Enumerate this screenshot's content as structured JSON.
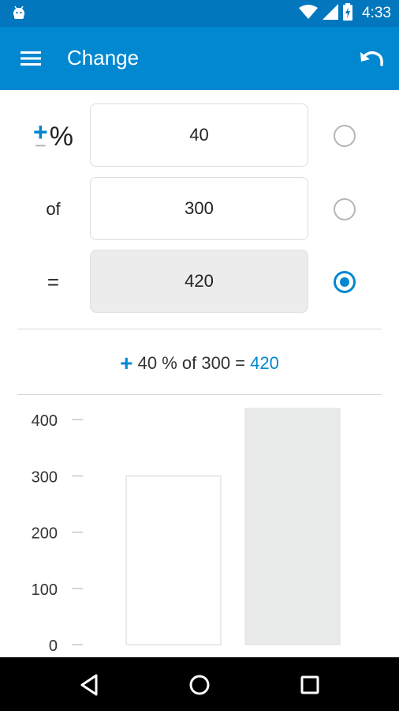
{
  "status_bar": {
    "time": "4:33"
  },
  "app_bar": {
    "title": "Change"
  },
  "calculator": {
    "sign_plus": "+",
    "sign_minus": "−",
    "percent_symbol": "%",
    "percent_value": "40",
    "of_label": "of",
    "base_value": "300",
    "equals_label": "=",
    "result_value": "420",
    "selected_radio": "result"
  },
  "summary": {
    "sign": "+",
    "text": " 40 % of 300 = ",
    "result": "420"
  },
  "chart_data": {
    "type": "bar",
    "categories": [
      "",
      ""
    ],
    "values": [
      300,
      420
    ],
    "ylim": [
      0,
      420
    ],
    "yticks": [
      "0",
      "100",
      "200",
      "300",
      "400"
    ],
    "bar_colors": [
      "#ffffff",
      "#e9ebeb"
    ],
    "grid": false
  },
  "colors": {
    "status_bar": "#0277bd",
    "app_bar": "#0288d1",
    "accent": "#0288d1"
  }
}
